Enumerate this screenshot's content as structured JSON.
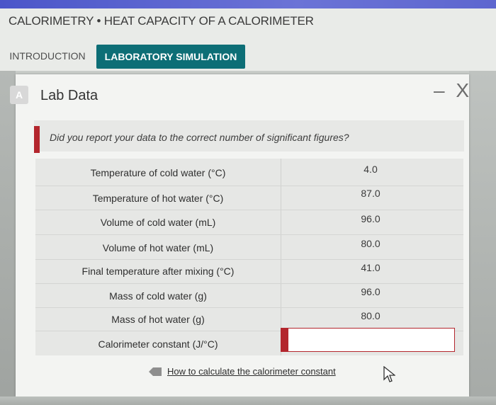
{
  "app": {
    "title": "CALORIMETRY • HEAT CAPACITY OF A CALORIMETER"
  },
  "tabs": [
    {
      "label": "INTRODUCTION"
    },
    {
      "label": "LABORATORY SIMULATION"
    }
  ],
  "panel": {
    "title": "Lab Data",
    "icon_letter": "A",
    "controls": {
      "minimize": "–",
      "close": "X"
    }
  },
  "prompt": {
    "text": "Did you report your data to the correct number of significant figures?"
  },
  "rows": [
    {
      "label": "Temperature of cold water (°C)",
      "value": "4.0"
    },
    {
      "label": "Temperature of hot water (°C)",
      "value": "87.0"
    },
    {
      "label": "Volume of cold water (mL)",
      "value": "96.0"
    },
    {
      "label": "Volume of hot water (mL)",
      "value": "80.0"
    },
    {
      "label": "Final temperature after mixing (°C)",
      "value": "41.0"
    },
    {
      "label": "Mass of cold water (g)",
      "value": "96.0"
    },
    {
      "label": "Mass of hot water (g)",
      "value": "80.0"
    },
    {
      "label": "Calorimeter constant (J/°C)",
      "value": ""
    }
  ],
  "help": {
    "link_text": "How to calculate the calorimeter constant"
  },
  "colors": {
    "accent_teal": "#0d6e76",
    "marker_red": "#b3262d"
  }
}
